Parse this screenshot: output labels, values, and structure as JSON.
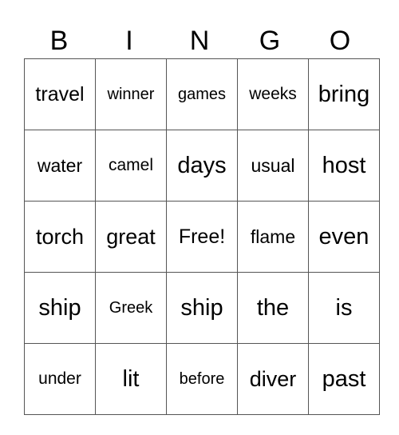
{
  "header": [
    "B",
    "I",
    "N",
    "G",
    "O"
  ],
  "rows": [
    [
      "travel",
      "winner",
      "games",
      "weeks",
      "bring"
    ],
    [
      "water",
      "camel",
      "days",
      "usual",
      "host"
    ],
    [
      "torch",
      "great",
      "Free!",
      "flame",
      "even"
    ],
    [
      "ship",
      "Greek",
      "ship",
      "the",
      "is"
    ],
    [
      "under",
      "lit",
      "before",
      "diver",
      "past"
    ]
  ]
}
